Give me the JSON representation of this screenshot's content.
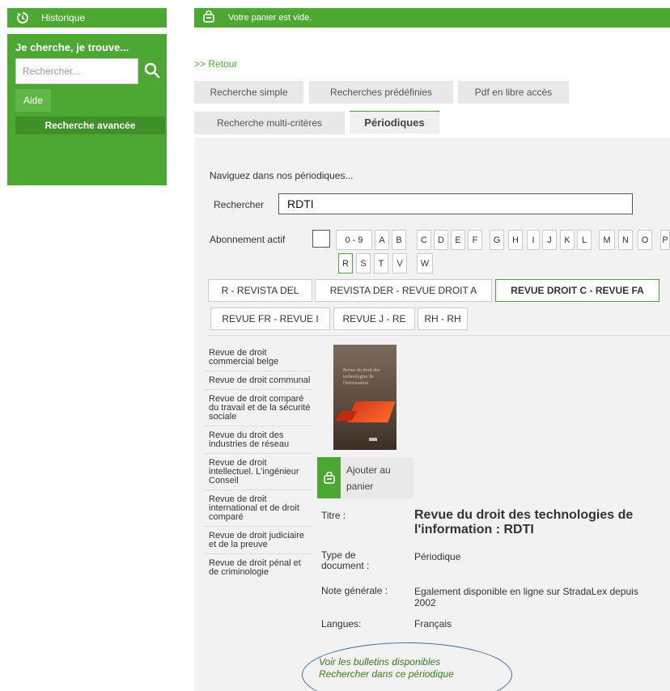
{
  "sidebar": {
    "historique_label": "Historique",
    "search_title": "Je cherche, je trouve...",
    "search_placeholder": "Rechercher...",
    "aide_label": "Aide",
    "advanced_label": "Recherche avancée"
  },
  "cart": {
    "status": "Votre panier est vide."
  },
  "retour": ">> Retour",
  "tabs": {
    "row1": [
      "Recherche simple",
      "Recherches prédéfinies",
      "Pdf en libre accès"
    ],
    "multi": "Recherche multi-critères",
    "periodiques": "Périodiques"
  },
  "browse": {
    "intro": "Naviguez dans nos périodiques...",
    "search_label": "Rechercher",
    "search_value": "RDTI",
    "abonnement_label": "Abonnement actif",
    "letters_row1": [
      "0 - 9",
      "A",
      "B",
      "C",
      "D",
      "E",
      "F",
      "G",
      "H",
      "I",
      "J",
      "K",
      "L",
      "M",
      "N",
      "O",
      "P"
    ],
    "letters_row2": [
      "R",
      "S",
      "T",
      "V",
      "W"
    ],
    "ranges_row1": [
      "R - REVISTA DEL",
      "REVISTA DER - REVUE DROIT A",
      "REVUE DROIT C - REVUE FA"
    ],
    "ranges_row2": [
      "REVUE FR - REVUE I",
      "REVUE J - RE",
      "RH - RH"
    ]
  },
  "titles": [
    "Revue de droit commercial belge",
    "Revue de droit communal",
    "Revue de droit comparé du travail et de la sécurité sociale",
    "Revue du droit des industries de réseau",
    "Revue de droit intellectuel. L'ingénieur Conseil",
    "Revue de droit international et de droit comparé",
    "Revue de droit judiciaire et de la preuve",
    "Revue de droit pénal et de criminologie"
  ],
  "cover_text": "Revue du droit des technologies de l'information",
  "ajouter_label": "Ajouter au panier",
  "record": {
    "titre_label": "Titre :",
    "titre_value": "Revue du droit des technologies de l'information : RDTI",
    "type_label": "Type de document :",
    "type_value": "Périodique",
    "note_label": "Note générale :",
    "note_value": "Egalement disponible en ligne sur StradaLex depuis 2002",
    "langues_label": "Langues:",
    "langues_value": "Français"
  },
  "links": {
    "bulletins": "Voir les bulletins disponibles",
    "rechercher": "Rechercher dans ce périodique"
  },
  "colors": {
    "green": "#4ca833",
    "dark_green": "#3e9128",
    "link_green": "#3b7a22",
    "oval_blue": "#3c6e98"
  }
}
